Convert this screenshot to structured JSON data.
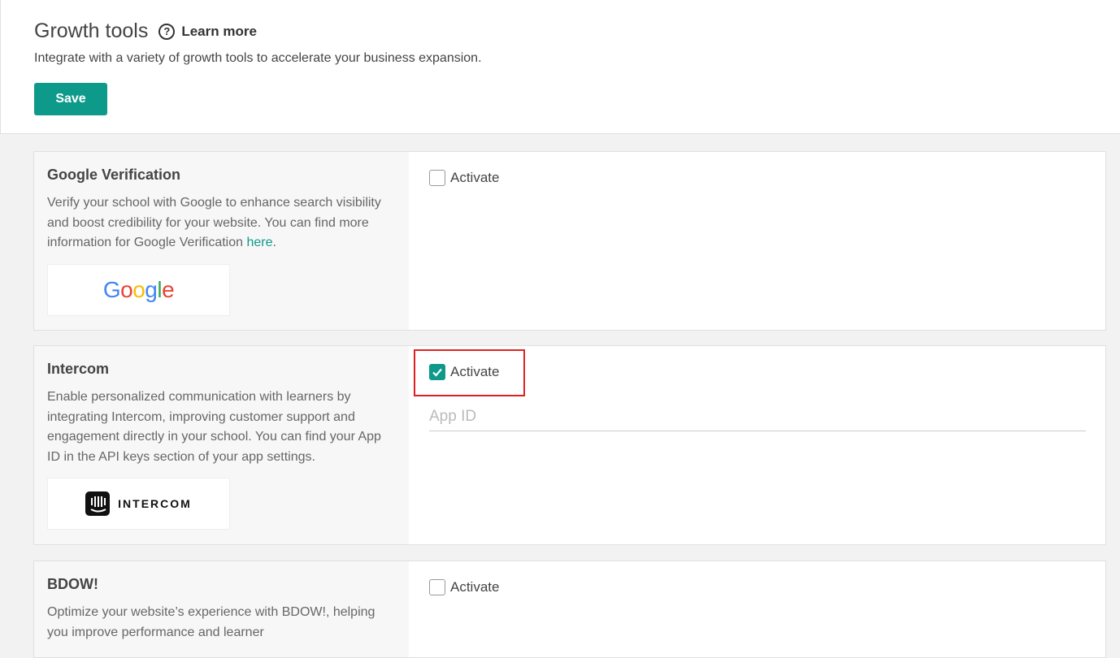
{
  "header": {
    "title": "Growth tools",
    "help_glyph": "?",
    "learn_more": "Learn more",
    "subtitle": "Integrate with a variety of growth tools to accelerate your business expansion.",
    "save_label": "Save"
  },
  "colors": {
    "accent": "#0e9a8a",
    "highlight_border": "#e02020"
  },
  "cards": [
    {
      "title": "Google Verification",
      "description_before": "Verify your school with Google to enhance search visibility and boost credibility for your website. You can find more information for Google Verification ",
      "description_link": "here",
      "description_after": ".",
      "logo_text": "Google",
      "activate_label": "Activate",
      "activated": false
    },
    {
      "title": "Intercom",
      "description": "Enable personalized communication with learners by integrating Intercom, improving customer support and engagement directly in your school. You can find your App ID in the API keys section of your app settings.",
      "logo_text": "INTERCOM",
      "activate_label": "Activate",
      "activated": true,
      "app_id_placeholder": "App ID",
      "app_id_value": ""
    },
    {
      "title": "BDOW!",
      "description": "Optimize your website’s experience with BDOW!, helping you improve performance and learner",
      "activate_label": "Activate",
      "activated": false
    }
  ]
}
